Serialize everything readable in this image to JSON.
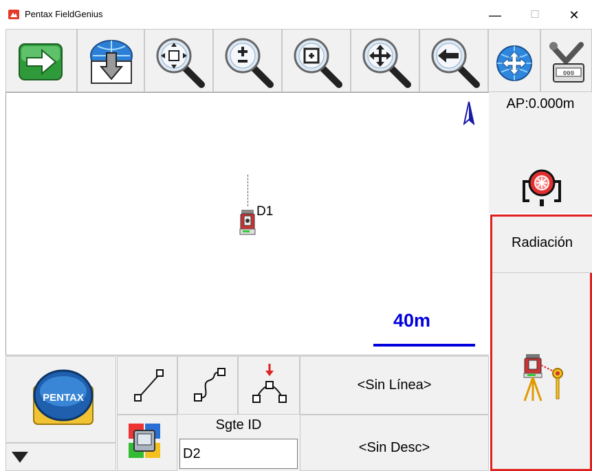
{
  "window": {
    "title": "Pentax FieldGenius",
    "minimize_glyph": "—",
    "maximize_glyph": "☐",
    "close_glyph": "✕"
  },
  "toolbar": {
    "buttons": [
      {
        "name": "next-arrow-icon"
      },
      {
        "name": "download-globe-icon"
      },
      {
        "name": "zoom-extents-icon"
      },
      {
        "name": "zoom-in-out-icon"
      },
      {
        "name": "zoom-window-icon"
      },
      {
        "name": "pan-icon"
      },
      {
        "name": "zoom-previous-icon"
      },
      {
        "name": "globe-move-icon"
      },
      {
        "name": "instrument-settings-icon"
      }
    ]
  },
  "map": {
    "point_label": "D1",
    "scale_label": "40m",
    "scale_color": "#0000dd",
    "north_color": "#1a1aaa"
  },
  "side": {
    "ap_label": "AP:0.000m",
    "mode_label": "Radiación"
  },
  "bottom": {
    "line_button": "<Sin Línea>",
    "desc_button": "<Sin Desc>",
    "next_id_label": "Sgte ID",
    "next_id_value": "D2",
    "brand_logo_text": "PENTAX"
  },
  "colors": {
    "accent_red": "#e02020",
    "panel_bg": "#f1f1f1"
  }
}
